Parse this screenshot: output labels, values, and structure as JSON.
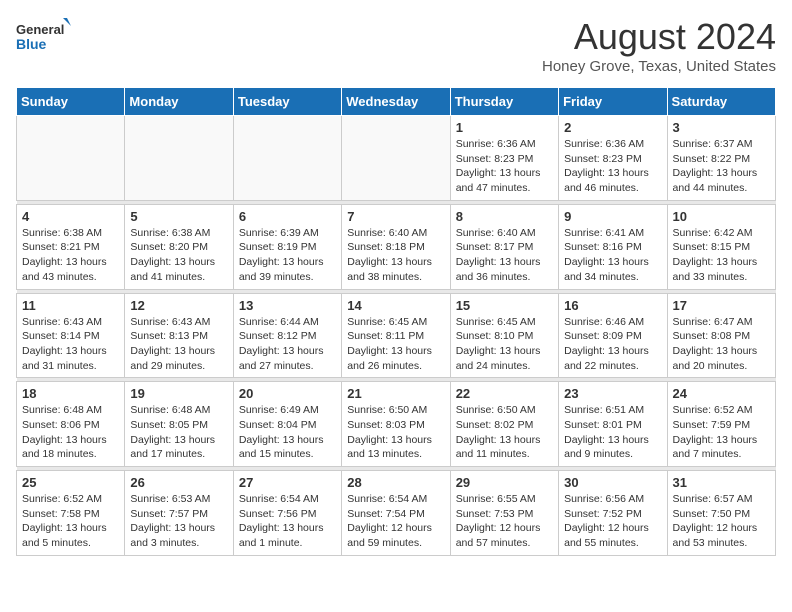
{
  "logo": {
    "line1": "General",
    "line2": "Blue"
  },
  "title": "August 2024",
  "subtitle": "Honey Grove, Texas, United States",
  "days_header": [
    "Sunday",
    "Monday",
    "Tuesday",
    "Wednesday",
    "Thursday",
    "Friday",
    "Saturday"
  ],
  "weeks": [
    [
      {
        "day": "",
        "info": ""
      },
      {
        "day": "",
        "info": ""
      },
      {
        "day": "",
        "info": ""
      },
      {
        "day": "",
        "info": ""
      },
      {
        "day": "1",
        "info": "Sunrise: 6:36 AM\nSunset: 8:23 PM\nDaylight: 13 hours\nand 47 minutes."
      },
      {
        "day": "2",
        "info": "Sunrise: 6:36 AM\nSunset: 8:23 PM\nDaylight: 13 hours\nand 46 minutes."
      },
      {
        "day": "3",
        "info": "Sunrise: 6:37 AM\nSunset: 8:22 PM\nDaylight: 13 hours\nand 44 minutes."
      }
    ],
    [
      {
        "day": "4",
        "info": "Sunrise: 6:38 AM\nSunset: 8:21 PM\nDaylight: 13 hours\nand 43 minutes."
      },
      {
        "day": "5",
        "info": "Sunrise: 6:38 AM\nSunset: 8:20 PM\nDaylight: 13 hours\nand 41 minutes."
      },
      {
        "day": "6",
        "info": "Sunrise: 6:39 AM\nSunset: 8:19 PM\nDaylight: 13 hours\nand 39 minutes."
      },
      {
        "day": "7",
        "info": "Sunrise: 6:40 AM\nSunset: 8:18 PM\nDaylight: 13 hours\nand 38 minutes."
      },
      {
        "day": "8",
        "info": "Sunrise: 6:40 AM\nSunset: 8:17 PM\nDaylight: 13 hours\nand 36 minutes."
      },
      {
        "day": "9",
        "info": "Sunrise: 6:41 AM\nSunset: 8:16 PM\nDaylight: 13 hours\nand 34 minutes."
      },
      {
        "day": "10",
        "info": "Sunrise: 6:42 AM\nSunset: 8:15 PM\nDaylight: 13 hours\nand 33 minutes."
      }
    ],
    [
      {
        "day": "11",
        "info": "Sunrise: 6:43 AM\nSunset: 8:14 PM\nDaylight: 13 hours\nand 31 minutes."
      },
      {
        "day": "12",
        "info": "Sunrise: 6:43 AM\nSunset: 8:13 PM\nDaylight: 13 hours\nand 29 minutes."
      },
      {
        "day": "13",
        "info": "Sunrise: 6:44 AM\nSunset: 8:12 PM\nDaylight: 13 hours\nand 27 minutes."
      },
      {
        "day": "14",
        "info": "Sunrise: 6:45 AM\nSunset: 8:11 PM\nDaylight: 13 hours\nand 26 minutes."
      },
      {
        "day": "15",
        "info": "Sunrise: 6:45 AM\nSunset: 8:10 PM\nDaylight: 13 hours\nand 24 minutes."
      },
      {
        "day": "16",
        "info": "Sunrise: 6:46 AM\nSunset: 8:09 PM\nDaylight: 13 hours\nand 22 minutes."
      },
      {
        "day": "17",
        "info": "Sunrise: 6:47 AM\nSunset: 8:08 PM\nDaylight: 13 hours\nand 20 minutes."
      }
    ],
    [
      {
        "day": "18",
        "info": "Sunrise: 6:48 AM\nSunset: 8:06 PM\nDaylight: 13 hours\nand 18 minutes."
      },
      {
        "day": "19",
        "info": "Sunrise: 6:48 AM\nSunset: 8:05 PM\nDaylight: 13 hours\nand 17 minutes."
      },
      {
        "day": "20",
        "info": "Sunrise: 6:49 AM\nSunset: 8:04 PM\nDaylight: 13 hours\nand 15 minutes."
      },
      {
        "day": "21",
        "info": "Sunrise: 6:50 AM\nSunset: 8:03 PM\nDaylight: 13 hours\nand 13 minutes."
      },
      {
        "day": "22",
        "info": "Sunrise: 6:50 AM\nSunset: 8:02 PM\nDaylight: 13 hours\nand 11 minutes."
      },
      {
        "day": "23",
        "info": "Sunrise: 6:51 AM\nSunset: 8:01 PM\nDaylight: 13 hours\nand 9 minutes."
      },
      {
        "day": "24",
        "info": "Sunrise: 6:52 AM\nSunset: 7:59 PM\nDaylight: 13 hours\nand 7 minutes."
      }
    ],
    [
      {
        "day": "25",
        "info": "Sunrise: 6:52 AM\nSunset: 7:58 PM\nDaylight: 13 hours\nand 5 minutes."
      },
      {
        "day": "26",
        "info": "Sunrise: 6:53 AM\nSunset: 7:57 PM\nDaylight: 13 hours\nand 3 minutes."
      },
      {
        "day": "27",
        "info": "Sunrise: 6:54 AM\nSunset: 7:56 PM\nDaylight: 13 hours\nand 1 minute."
      },
      {
        "day": "28",
        "info": "Sunrise: 6:54 AM\nSunset: 7:54 PM\nDaylight: 12 hours\nand 59 minutes."
      },
      {
        "day": "29",
        "info": "Sunrise: 6:55 AM\nSunset: 7:53 PM\nDaylight: 12 hours\nand 57 minutes."
      },
      {
        "day": "30",
        "info": "Sunrise: 6:56 AM\nSunset: 7:52 PM\nDaylight: 12 hours\nand 55 minutes."
      },
      {
        "day": "31",
        "info": "Sunrise: 6:57 AM\nSunset: 7:50 PM\nDaylight: 12 hours\nand 53 minutes."
      }
    ]
  ]
}
